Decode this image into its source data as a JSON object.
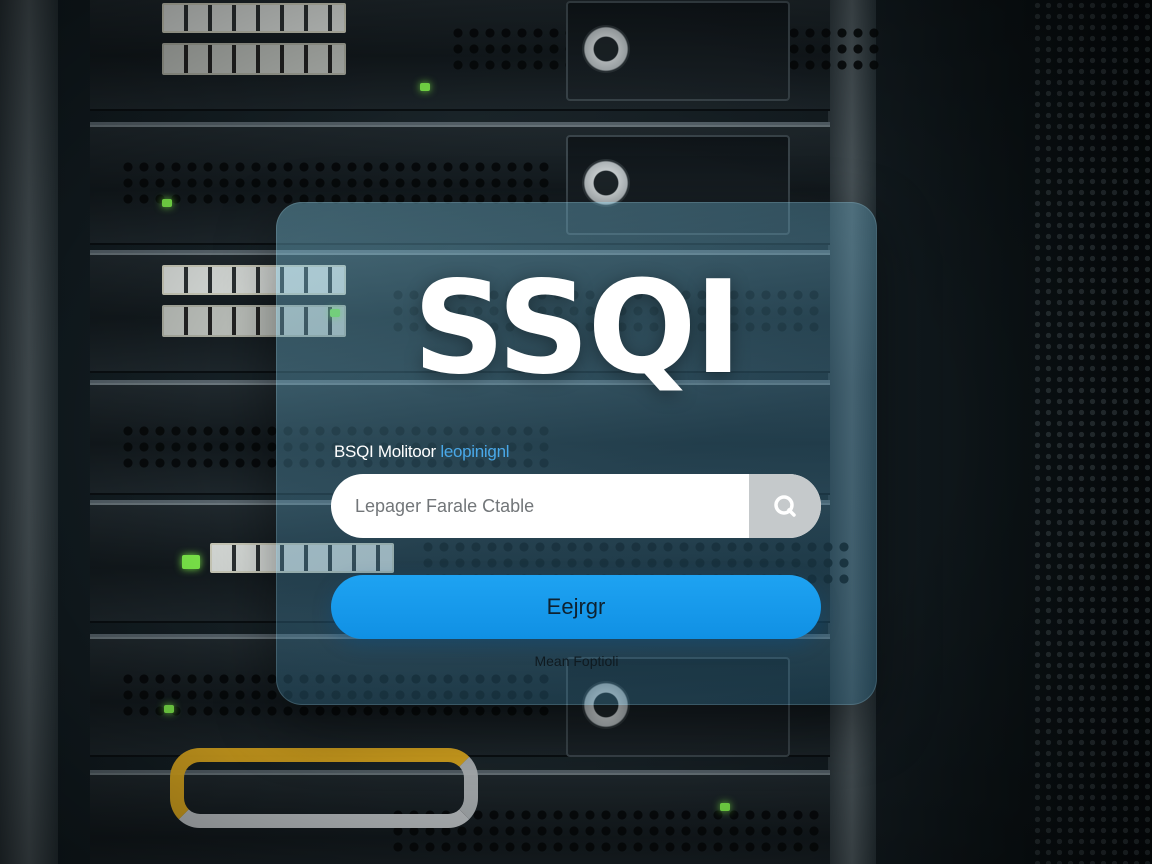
{
  "app": {
    "title": "SSQI",
    "subtitle_main": "BSQI Molitoor",
    "subtitle_accent": "leopinignl"
  },
  "search": {
    "placeholder": "Lepager Farale Ctable",
    "icon": "search-icon"
  },
  "actions": {
    "primary_label": "Eejrgr",
    "footer_link": "Mean Foptioli"
  },
  "colors": {
    "primary": "#1ea3f2",
    "accent_text": "#49a8e8",
    "panel_tint": "#3c7896"
  }
}
